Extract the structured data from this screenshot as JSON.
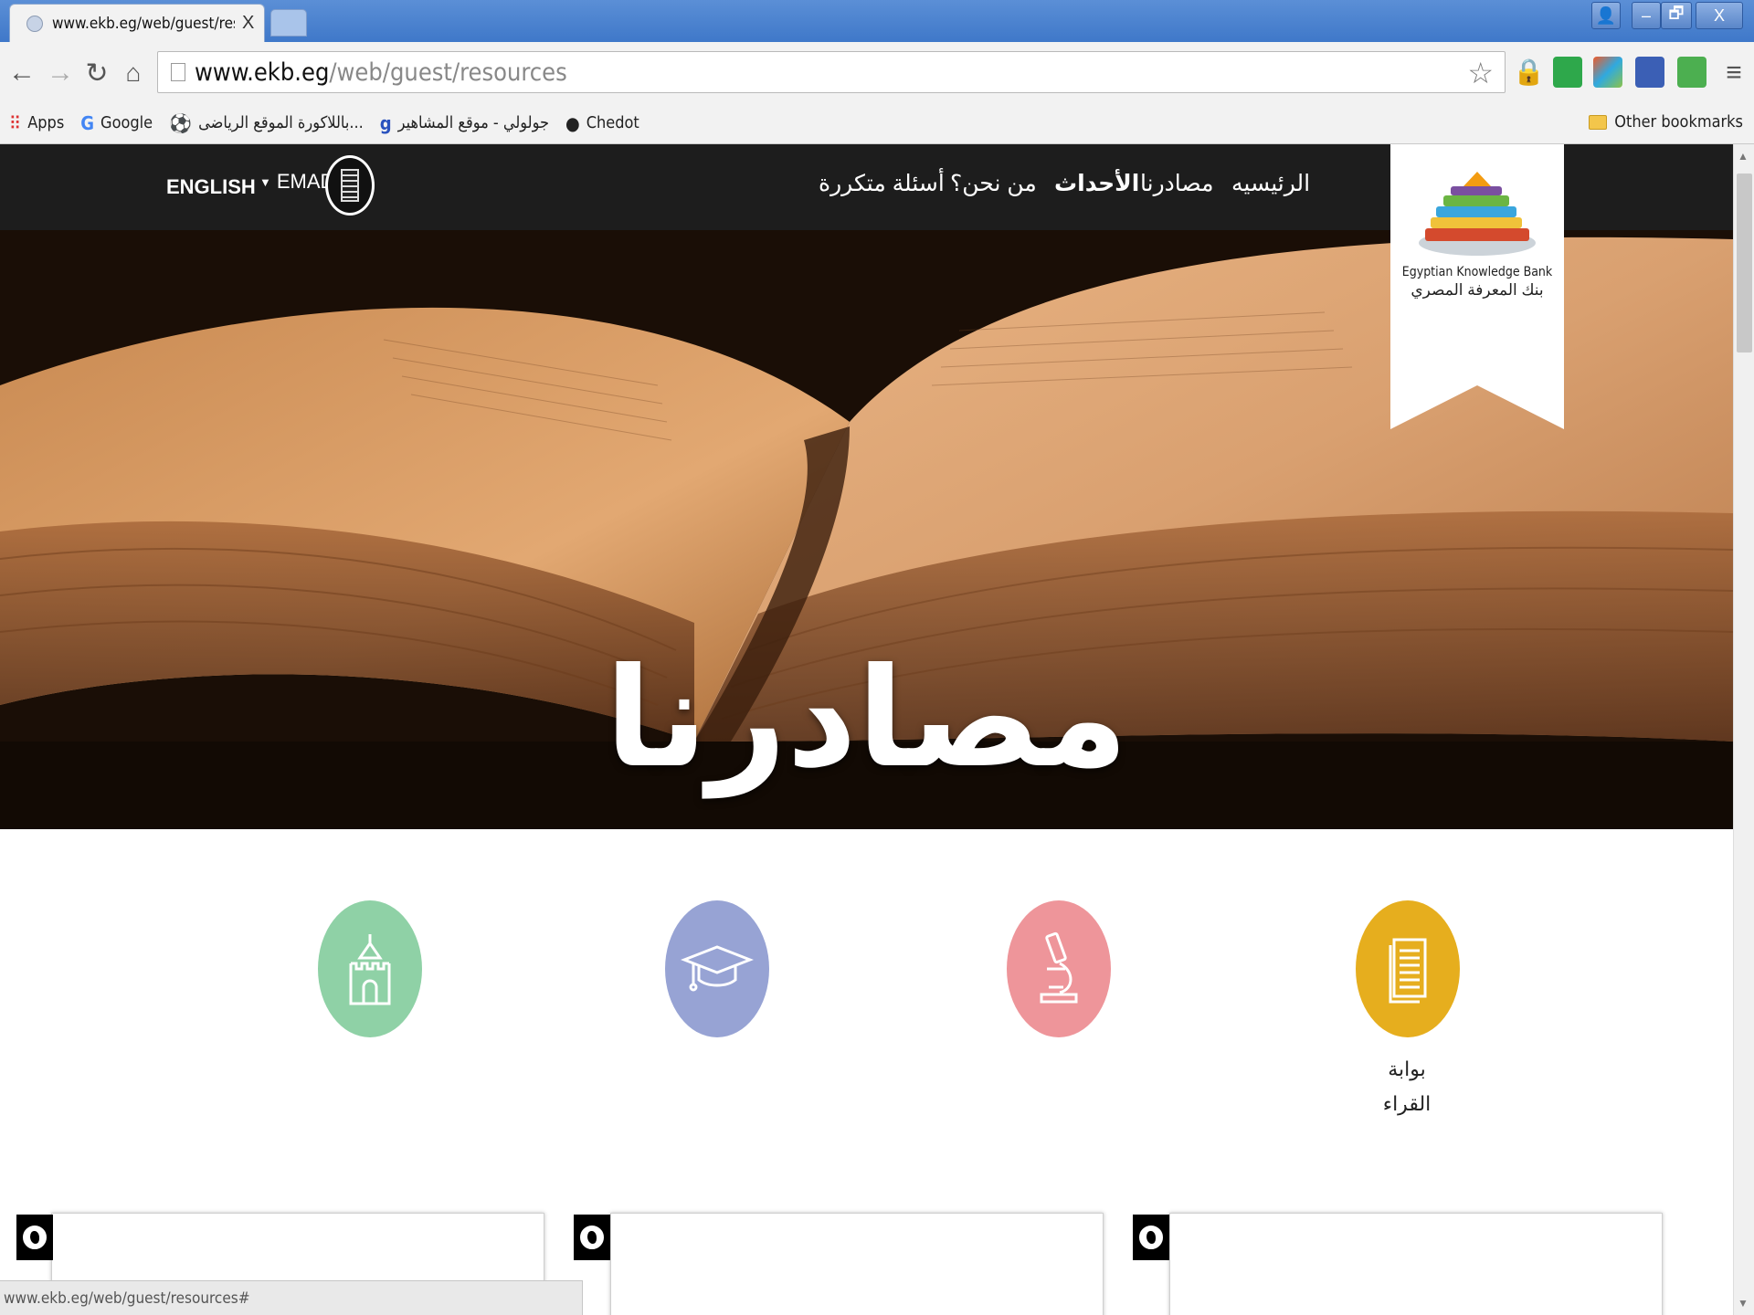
{
  "browser": {
    "tab_title": "www.ekb.eg/web/guest/reso",
    "tab_close": "X",
    "url_host": "www.ekb.eg",
    "url_path": "/web/guest/resources",
    "status_url": "www.ekb.eg/web/guest/resources#",
    "window_controls": {
      "minimize": "–",
      "restore": "🗗",
      "close": "X"
    }
  },
  "bookmarks": [
    {
      "label": "Apps",
      "icon": "apps-grid-icon"
    },
    {
      "label": "Google",
      "icon": "google-icon"
    },
    {
      "label": "...باللاكورة الموقع الرياضى",
      "icon": "football-icon"
    },
    {
      "label": "جولولي - موقع المشاهير",
      "icon": "goloooly-icon"
    },
    {
      "label": "Chedot",
      "icon": "chedot-icon"
    }
  ],
  "other_bookmarks": "Other bookmarks",
  "site": {
    "language_toggle": "ENGLISH",
    "user_name": "EMAD",
    "nav": {
      "home": "الرئيسيه",
      "resources": "مصادرنا",
      "events": "الأحداث",
      "about": "من نحن؟",
      "faq": "أسئلة متكررة"
    },
    "logo_text_en": "Egyptian Knowledge Bank",
    "logo_text_ar": "بنك المعرفة المصري",
    "hero_title": "مصادرنا",
    "resources": [
      {
        "icon": "castle-icon",
        "color": "#8fd1a6",
        "label": ""
      },
      {
        "icon": "graduation-cap-icon",
        "color": "#97a3d4",
        "label": ""
      },
      {
        "icon": "microscope-icon",
        "color": "#ee959a",
        "label": ""
      },
      {
        "icon": "documents-icon",
        "color": "#e6ae1e",
        "label": "بوابة القراء"
      }
    ],
    "resource_label_line1": "بوابة",
    "resource_label_line2": "القراء"
  }
}
